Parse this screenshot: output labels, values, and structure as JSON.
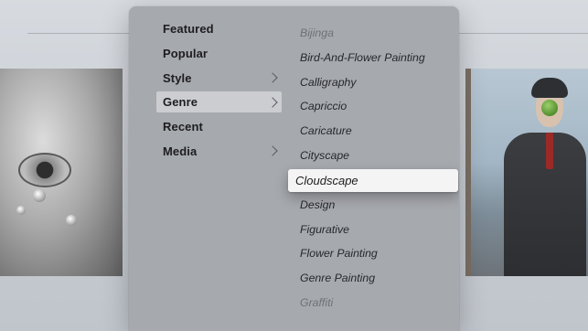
{
  "categories": [
    {
      "label": "Featured",
      "has_submenu": false,
      "selected": false
    },
    {
      "label": "Popular",
      "has_submenu": false,
      "selected": false
    },
    {
      "label": "Style",
      "has_submenu": true,
      "selected": false
    },
    {
      "label": "Genre",
      "has_submenu": true,
      "selected": true
    },
    {
      "label": "Recent",
      "has_submenu": false,
      "selected": false
    },
    {
      "label": "Media",
      "has_submenu": true,
      "selected": false
    }
  ],
  "genres": [
    {
      "label": "Bijinga",
      "state": "faded"
    },
    {
      "label": "Bird-And-Flower Painting",
      "state": "normal"
    },
    {
      "label": "Calligraphy",
      "state": "normal"
    },
    {
      "label": "Capriccio",
      "state": "normal"
    },
    {
      "label": "Caricature",
      "state": "normal"
    },
    {
      "label": "Cityscape",
      "state": "normal"
    },
    {
      "label": "Cloudscape",
      "state": "focused"
    },
    {
      "label": "Design",
      "state": "normal"
    },
    {
      "label": "Figurative",
      "state": "normal"
    },
    {
      "label": "Flower Painting",
      "state": "normal"
    },
    {
      "label": "Genre Painting",
      "state": "normal"
    },
    {
      "label": "Graffiti",
      "state": "faded"
    }
  ],
  "colors": {
    "panel": "#a6a9ae",
    "focus_highlight": "#f4f4f4",
    "selected_category": "rgba(255,255,255,0.42)"
  }
}
